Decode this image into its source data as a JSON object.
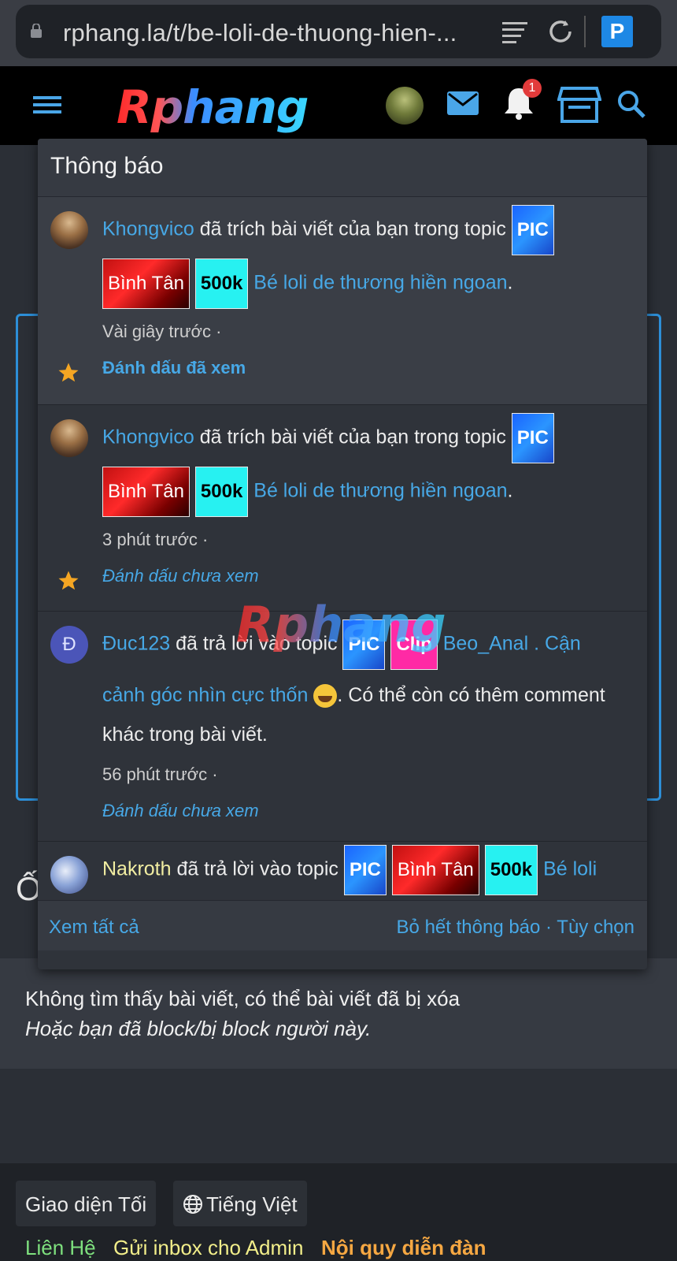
{
  "browser": {
    "url": "rphang.la/t/be-loli-de-thuong-hien-...",
    "tab_badge": "P"
  },
  "header": {
    "logo": "Rphang",
    "notification_count": "1"
  },
  "notifications": {
    "title": "Thông báo",
    "items": [
      {
        "user": "Khongvico",
        "action": "đã trích bài viết của bạn trong topic",
        "tags": [
          "PIC",
          "Bình Tân",
          "500k"
        ],
        "topic": "Bé loli de thương hiền ngoan",
        "suffix": ".",
        "time": "Vài giây trước ·",
        "mark": "Đánh dấu đã xem"
      },
      {
        "user": "Khongvico",
        "action": "đã trích bài viết của bạn trong topic",
        "tags": [
          "PIC",
          "Bình Tân",
          "500k"
        ],
        "topic": "Bé loli de thương hiền ngoan",
        "suffix": ".",
        "time": "3 phút trước ·",
        "mark": "Đánh dấu chưa xem"
      },
      {
        "avatar_letter": "Đ",
        "user": "Đuc123",
        "action": "đã trả lời vào topic",
        "tags": [
          "PIC",
          "Clip"
        ],
        "topic_line1": "Beo_Anal . Cận",
        "topic_line2": "cảnh góc nhìn cực thốn",
        "suffix_line2": ". Có thể còn có thêm comment",
        "line3": "khác trong bài viết.",
        "time": "56 phút trước ·",
        "mark": "Đánh dấu chưa xem"
      },
      {
        "user": "Nakroth",
        "action": "đã trả lời vào topic",
        "tags": [
          "PIC",
          "Bình Tân",
          "500k"
        ],
        "topic": "Bé loli"
      }
    ],
    "footer": {
      "see_all": "Xem tất cả",
      "dismiss_all": "Bỏ hết thông báo",
      "separator": "·",
      "options": "Tùy chọn"
    }
  },
  "page": {
    "partial_heading": "Ố",
    "not_found_line1": "Không tìm thấy bài viết, có thể bài viết đã bị xóa",
    "not_found_line2": "Hoặc bạn đã block/bị block người này."
  },
  "footer": {
    "theme_button": "Giao diện Tối",
    "language_button": "Tiếng Việt",
    "links": [
      "Liên Hệ",
      "Gửi inbox cho Admin",
      "Nội quy diễn đàn"
    ],
    "link_colors": [
      "#7ee07e",
      "#f2ee8a",
      "#f5a742"
    ]
  },
  "watermark": "Rphang",
  "colors": {
    "link_blue": "#47a8e6",
    "accent_blue": "#2d8fd8",
    "badge_red": "#e23b3b"
  }
}
